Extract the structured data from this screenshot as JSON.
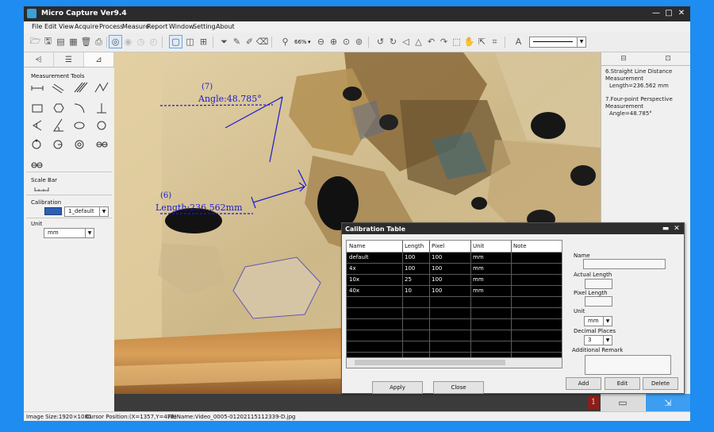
{
  "app": {
    "title": "Micro Capture Ver9.4"
  },
  "window_buttons": {
    "minimize": "—",
    "maximize": "□",
    "close": "✕"
  },
  "menu": [
    "File",
    "Edit",
    "View",
    "Acquire",
    "Process",
    "Measure",
    "Report",
    "Window",
    "Setting",
    "About"
  ],
  "toolbar": {
    "zoom_label": "66%",
    "zoom_dropdown": "▾"
  },
  "left_panel": {
    "section_tools": "Measurement Tools",
    "section_scale": "Scale Bar",
    "section_calibration": "Calibration",
    "calibration_value": "1_default",
    "section_unit": "Unit",
    "unit_value": "mm"
  },
  "overlay": {
    "label7": "(7)",
    "angle_text": "Angle:48.785°",
    "label6": "(6)",
    "length_text": "Length:236.562mm"
  },
  "right_panel": {
    "item1_title": "6.Straight Line Distance Measurement",
    "item1_value": "Length=236.562 mm",
    "item2_title": "7.Four-point Perspective Measurement",
    "item2_value": "Angle=48.785°"
  },
  "footer": {
    "badge": "1"
  },
  "status": {
    "size": "Image Size:1920×1080",
    "cursor": "Cursor Position:(X=1357,Y=478)",
    "file": "FileName:Video_0005-01202115112339-D.jpg"
  },
  "dialog": {
    "title": "Calibration Table",
    "columns": [
      "Name",
      "Length",
      "Pixel",
      "Unit",
      "Note"
    ],
    "rows": [
      [
        "default",
        "100",
        "100",
        "mm",
        ""
      ],
      [
        "4x",
        "100",
        "100",
        "mm",
        ""
      ],
      [
        "10x",
        "25",
        "100",
        "mm",
        ""
      ],
      [
        "40x",
        "10",
        "100",
        "mm",
        ""
      ]
    ],
    "apply": "Apply",
    "close": "Close",
    "fields": {
      "name_label": "Name",
      "actual_length_label": "Actual Length",
      "pixel_length_label": "Pixel Length",
      "unit_label": "Unit",
      "unit_value": "mm",
      "decimal_label": "Decimal Places",
      "decimal_value": "3",
      "remark_label": "Additional Remark"
    },
    "add": "Add",
    "edit": "Edit",
    "delete": "Delete"
  },
  "colors": {
    "title_bar": "#2b2b2b",
    "desktop": "#1e8cf0",
    "annotation": "#1a1ad0",
    "grid_bg": "#000000"
  }
}
